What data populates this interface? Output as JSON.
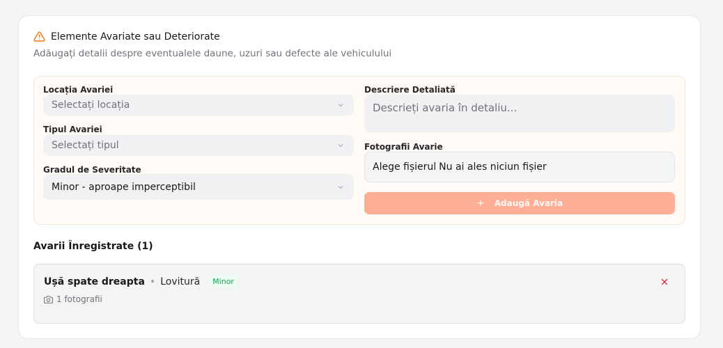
{
  "header": {
    "title": "Elemente Avariate sau Deteriorate",
    "subtitle": "Adăugați detalii despre eventualele daune, uzuri sau defecte ale vehiculului",
    "icon": "warning-triangle-icon"
  },
  "form": {
    "location": {
      "label": "Locația Avariei",
      "placeholder": "Selectați locația"
    },
    "type": {
      "label": "Tipul Avariei",
      "placeholder": "Selectați tipul"
    },
    "severity": {
      "label": "Gradul de Severitate",
      "value": "Minor - aproape imperceptibil"
    },
    "description": {
      "label": "Descriere Detaliată",
      "placeholder": "Descrieți avaria în detaliu..."
    },
    "photos": {
      "label": "Fotografii Avarie",
      "button": "Alege fișierul",
      "status": "Nu ai ales niciun fișier"
    },
    "add_button": "Adaugă Avaria"
  },
  "records": {
    "title": "Avarii Înregistrate (1)",
    "items": [
      {
        "location": "Ușă spate dreapta",
        "type": "Lovitură",
        "severity": "Minor",
        "photos": "1 fotografii"
      }
    ]
  },
  "colors": {
    "accent": "#fdae94",
    "warning": "#f97316",
    "severity_minor": "#16a34a",
    "remove": "#dc2626"
  }
}
